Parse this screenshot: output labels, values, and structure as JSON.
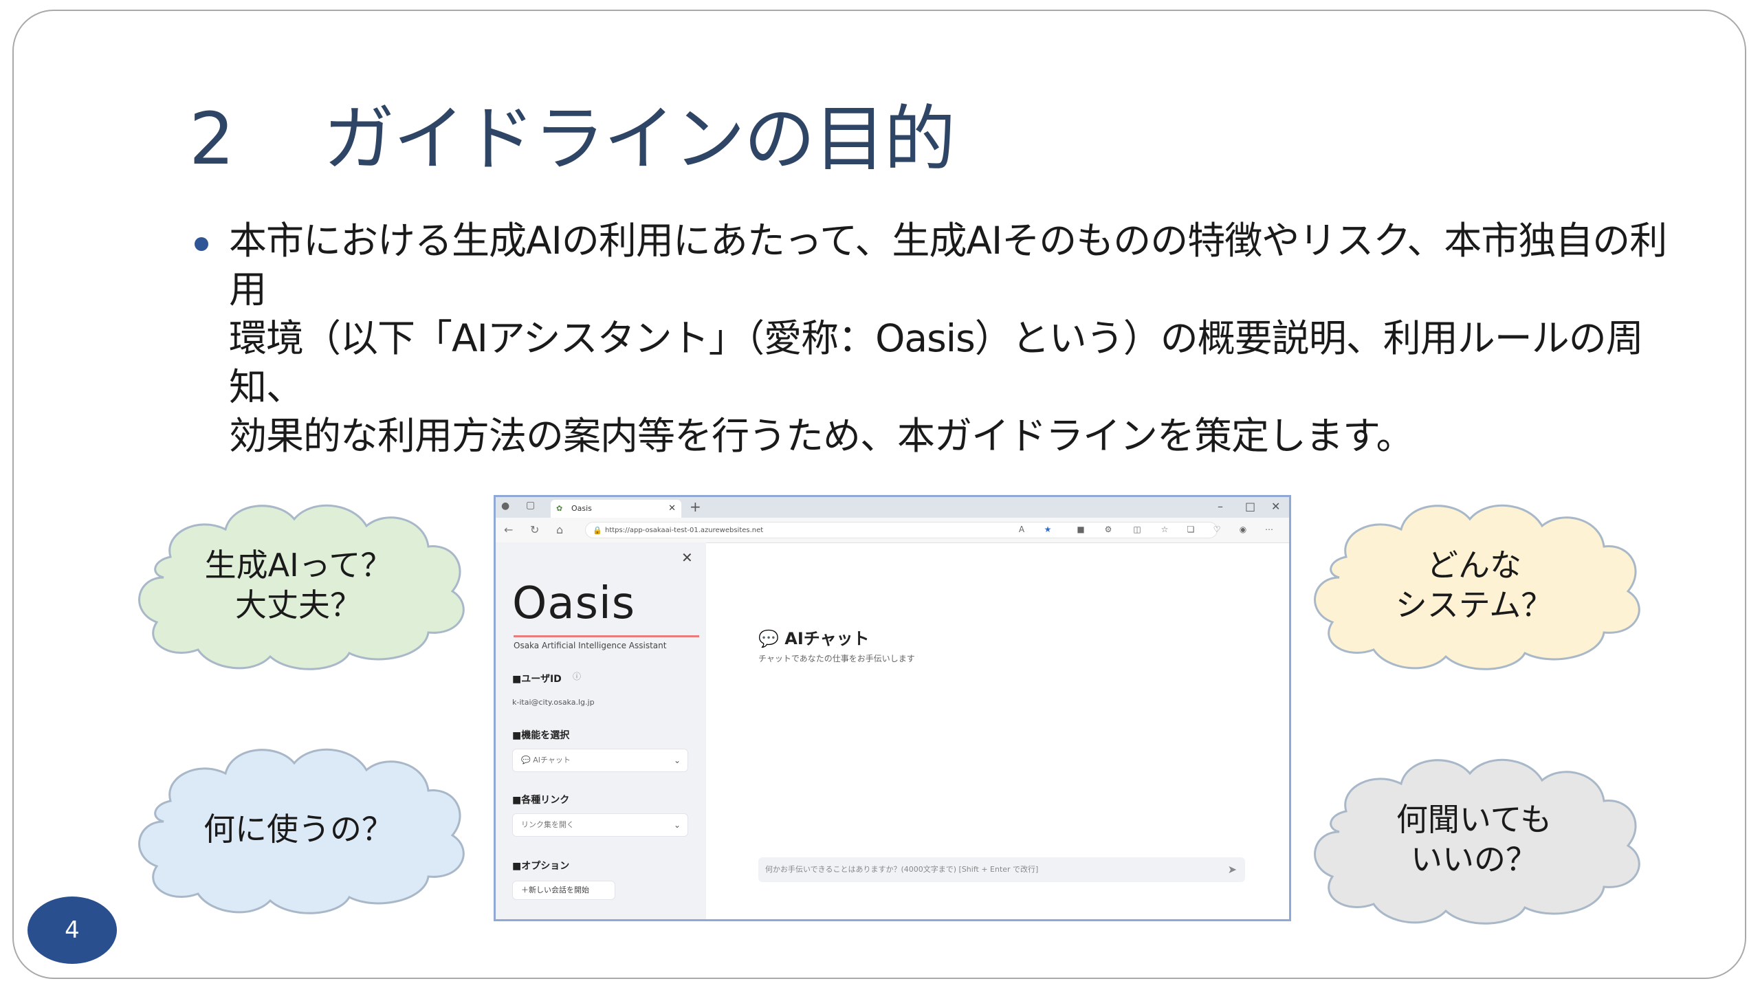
{
  "slide": {
    "title_number": "2",
    "title_text": "ガイドラインの目的",
    "bullet": "本市における生成AIの利用にあたって、生成AIそのものの特徴やリスク、本市独自の利用\n環境（以下「AIアシスタント」（愛称：Oasis）という）の概要説明、利用ルールの周知、\n効果的な利用方法の案内等を行うため、本ガイドラインを策定します。",
    "page_number": "4"
  },
  "clouds": [
    {
      "text": "生成AIって？\n大丈夫？",
      "color": "#dfeed7"
    },
    {
      "text": "何に使うの？",
      "color": "#dce9f7"
    },
    {
      "text": "どんな\nシステム？",
      "color": "#fdf2d3"
    },
    {
      "text": "何聞いても\nいいの？",
      "color": "#e6e6e6"
    }
  ],
  "browser": {
    "tab_title": "Oasis",
    "url": "https://app-osakaai-test-01.azurewebsites.net",
    "sidebar": {
      "logo": "Oasis",
      "logo_sub": "Osaka Artificial Intelligence Assistant",
      "user_id_label": "■ユーザID",
      "user_id_value": "k-itai@city.osaka.lg.jp",
      "function_label": "■機能を選択",
      "function_value": "AIチャット",
      "links_label": "■各種リンク",
      "links_value": "リンク集を開く",
      "options_label": "■オプション",
      "new_chat_button": "＋新しい会話を開始"
    },
    "main": {
      "title": "AIチャット",
      "subtitle": "チャットであなたの仕事をお手伝いします",
      "input_placeholder": "何かお手伝いできることはありますか？(4000文字まで)  [Shift + Enter で改行]"
    }
  }
}
